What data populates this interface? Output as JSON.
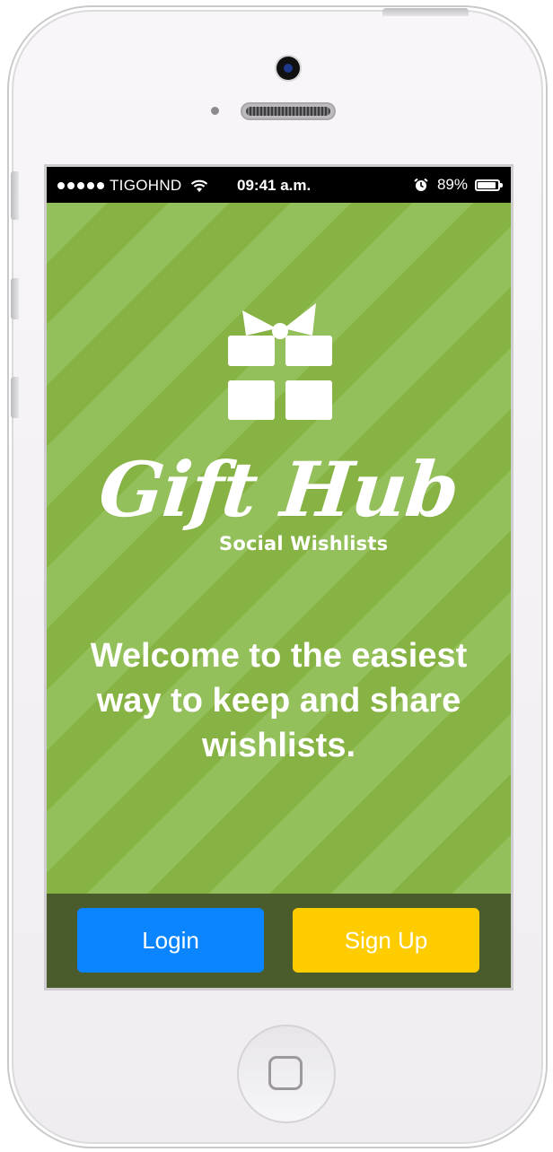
{
  "status_bar": {
    "carrier": "TIGOHND",
    "time": "09:41 a.m.",
    "battery_percent": "89%",
    "battery_level": 0.89
  },
  "app": {
    "logo_title": "Gift Hub",
    "logo_subtitle": "Social Wishlists",
    "welcome_text": "Welcome to the easiest way to keep and share wishlists."
  },
  "actions": {
    "login_label": "Login",
    "signup_label": "Sign Up"
  },
  "colors": {
    "background_green": "#8bb84a",
    "bottom_bar": "#4a5b2c",
    "login_button": "#0a84ff",
    "signup_button": "#ffcc00"
  },
  "icons": {
    "gift": "gift-icon",
    "wifi": "wifi-icon",
    "alarm": "alarm-icon",
    "battery": "battery-icon"
  }
}
